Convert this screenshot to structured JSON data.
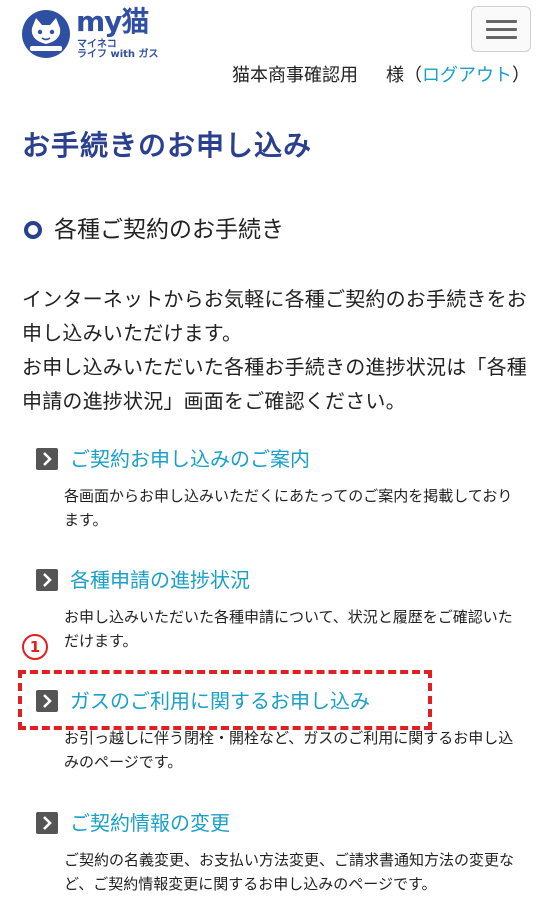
{
  "header": {
    "logo": {
      "main_text": "my猫",
      "sub_text_1": "マイネコ",
      "sub_text_2": "ライフ with ガス"
    },
    "menu_icon": "hamburger-menu-icon",
    "user_name": "猫本商事確認用",
    "honorific": "様（",
    "logout_label": "ログアウト",
    "close_paren": "）"
  },
  "page_title": "お手続きのお申し込み",
  "section": {
    "title": "各種ご契約のお手続き",
    "intro_line_1": "インターネットからお気軽に各種ご契約のお手続きをお申し込みいただけます。",
    "intro_line_2": "お申し込みいただいた各種お手続きの進捗状況は「各種申請の進捗状況」画面をご確認ください。"
  },
  "items": [
    {
      "label": "ご契約お申し込みのご案内",
      "description": "各画面からお申し込みいただくにあたってのご案内を掲載しております。"
    },
    {
      "label": "各種申請の進捗状況",
      "description": "お申し込みいただいた各種申請について、状況と履歴をご確認いただけます。"
    },
    {
      "label": "ガスのご利用に関するお申し込み",
      "description": "お引っ越しに伴う閉栓・開栓など、ガスのご利用に関するお申し込みのページです。"
    },
    {
      "label": "ご契約情報の変更",
      "description": "ご契約の名義変更、お支払い方法変更、ご請求書通知方法の変更など、ご契約情報変更に関するお申し込みのページです。"
    }
  ],
  "annotation": {
    "number": "1"
  },
  "colors": {
    "brand_navy": "#2a3f8f",
    "link_cyan": "#1aa0c8",
    "annotation_red": "#e02020"
  }
}
